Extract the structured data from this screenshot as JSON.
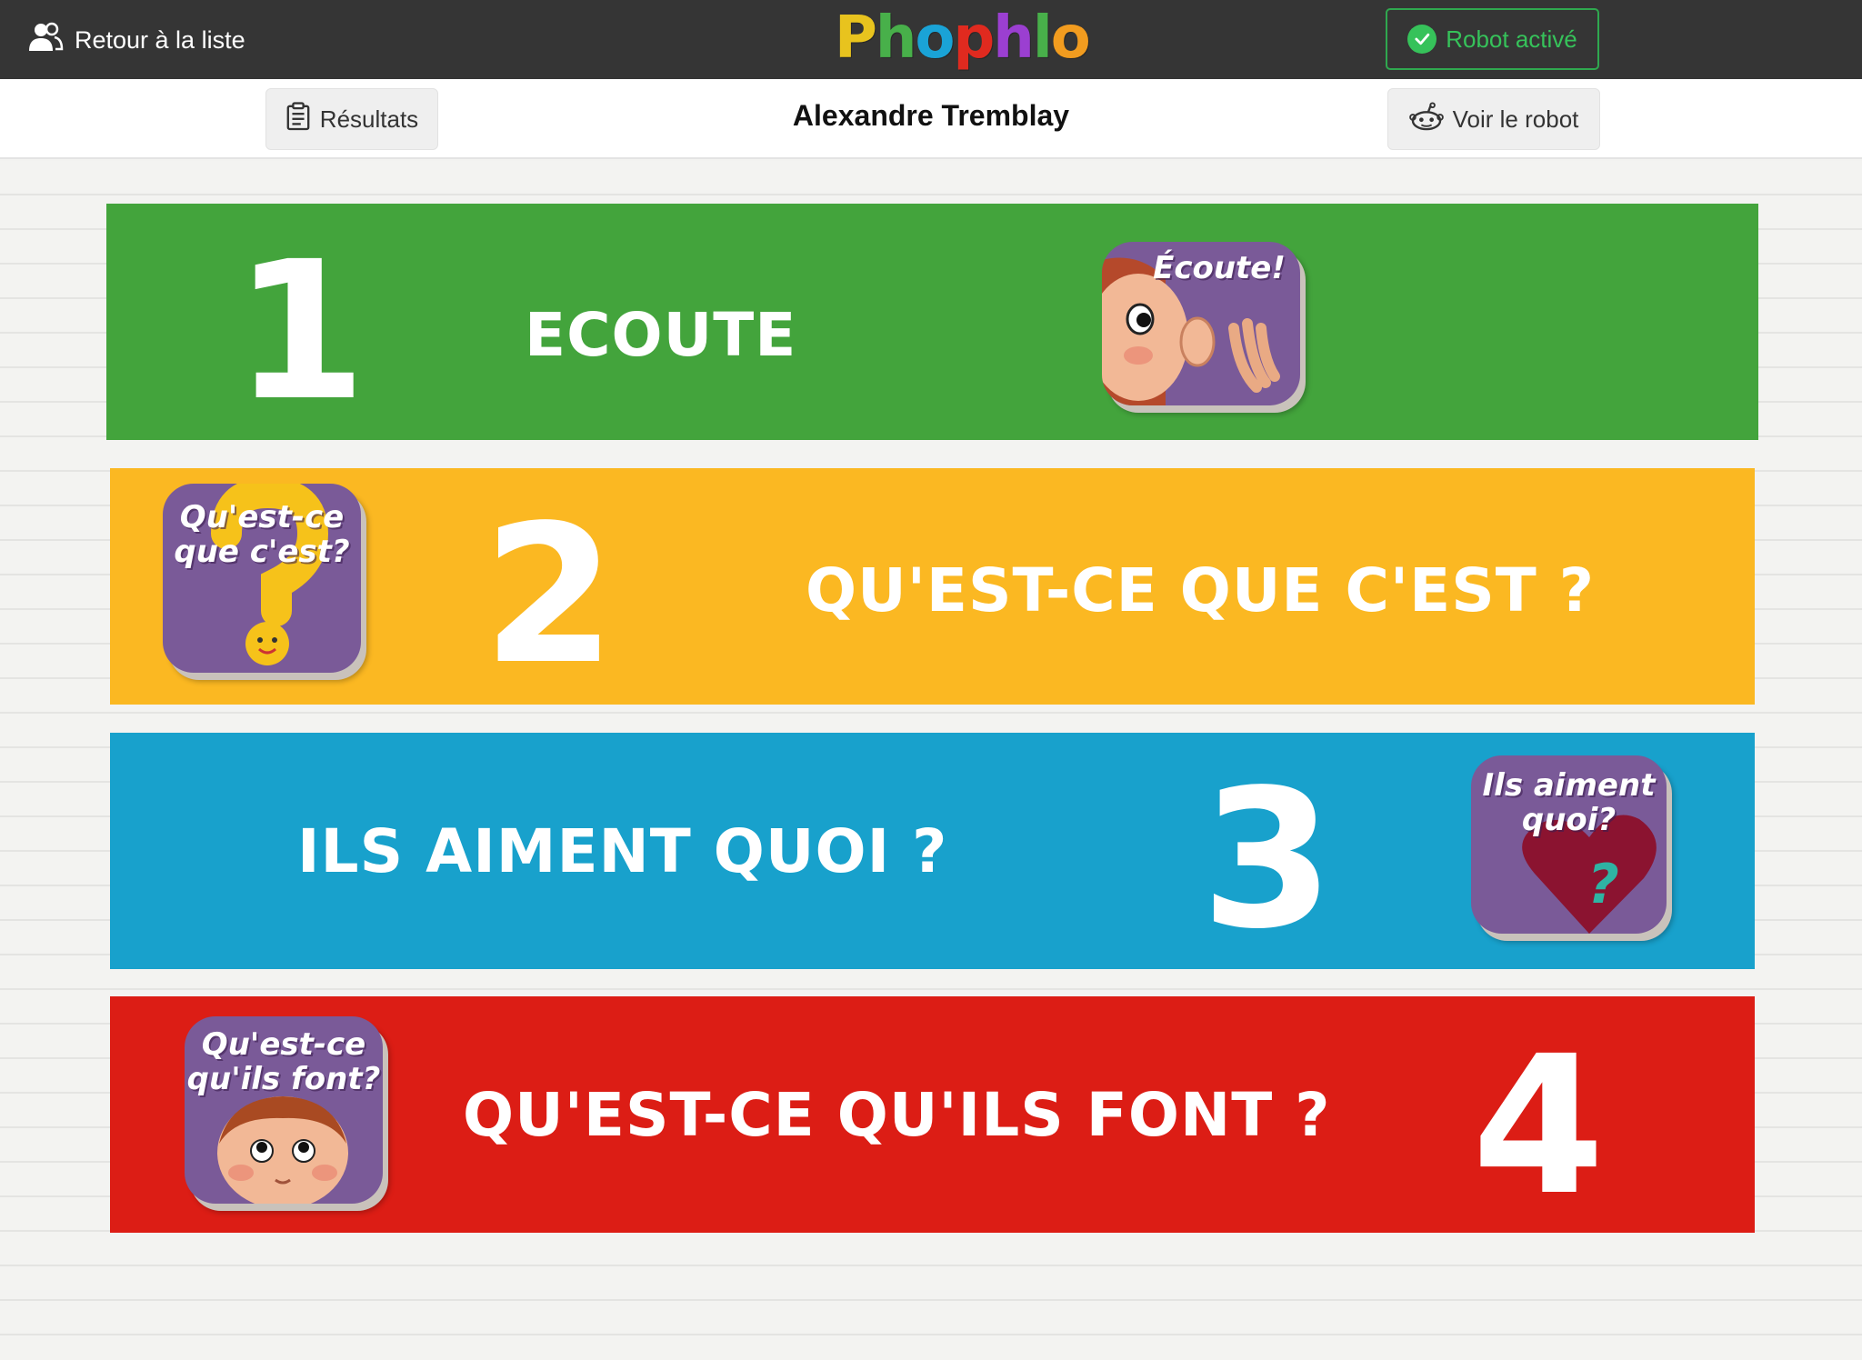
{
  "topbar": {
    "back_label": "Retour à la liste",
    "logo_letters": [
      {
        "char": "P",
        "color": "#e8c31e"
      },
      {
        "char": "h",
        "color": "#48b04a"
      },
      {
        "char": "o",
        "color": "#1aa3d6"
      },
      {
        "char": "p",
        "color": "#e02a1f"
      },
      {
        "char": "h",
        "color": "#9b3fd1"
      },
      {
        "char": "l",
        "color": "#48b04a"
      },
      {
        "char": "o",
        "color": "#f29c1f"
      }
    ],
    "robot_status_label": "Robot activé"
  },
  "subbar": {
    "results_label": "Résultats",
    "student_name": "Alexandre Tremblay",
    "view_robot_label": "Voir le robot"
  },
  "activities": [
    {
      "number": "1",
      "title": "ECOUTE",
      "color": "#43a43c",
      "tile_text": "Écoute!",
      "tile_icon": "listening-child-icon"
    },
    {
      "number": "2",
      "title": "QU'EST-CE QUE C'EST ?",
      "color": "#fbb822",
      "tile_text": "Qu'est-ce que c'est?",
      "tile_icon": "question-mark-icon"
    },
    {
      "number": "3",
      "title": "ILS AIMENT QUOI ?",
      "color": "#18a1cc",
      "tile_text": "Ils aiment quoi?",
      "tile_icon": "heart-question-icon"
    },
    {
      "number": "4",
      "title": "QU'EST-CE QU'ILS FONT ?",
      "color": "#dc1d15",
      "tile_text": "Qu'est-ce qu'ils font?",
      "tile_icon": "child-face-icon"
    }
  ],
  "colors": {
    "topbar_bg": "#353535",
    "robot_status_green": "#36c25a"
  }
}
